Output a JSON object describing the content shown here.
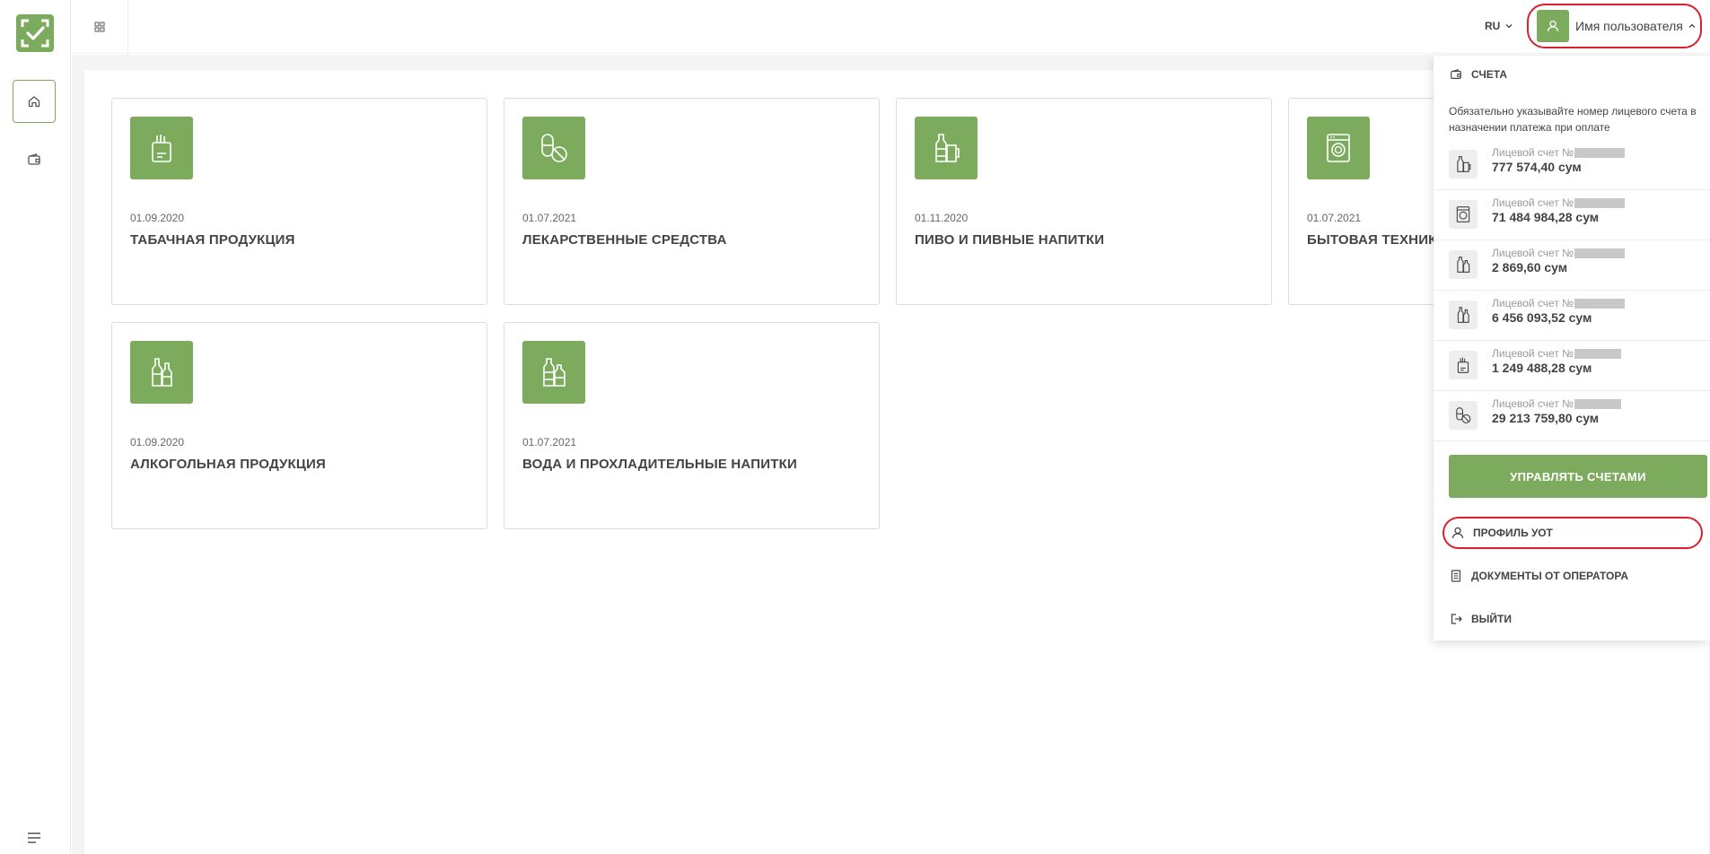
{
  "topbar": {
    "language": "RU",
    "user_name": "Имя пользователя"
  },
  "cards": [
    {
      "date": "01.09.2020",
      "title": "ТАБАЧНАЯ ПРОДУКЦИЯ",
      "icon": "tobacco-icon"
    },
    {
      "date": "01.07.2021",
      "title": "ЛЕКАРСТВЕННЫЕ СРЕДСТВА",
      "icon": "pills-icon"
    },
    {
      "date": "01.11.2020",
      "title": "ПИВО И ПИВНЫЕ НАПИТКИ",
      "icon": "beer-icon"
    },
    {
      "date": "01.07.2021",
      "title": "БЫТОВАЯ ТЕХНИКА",
      "icon": "washing-machine-icon"
    },
    {
      "date": "01.09.2020",
      "title": "АЛКОГОЛЬНАЯ ПРОДУКЦИЯ",
      "icon": "alcohol-icon"
    },
    {
      "date": "01.07.2021",
      "title": "ВОДА И ПРОХЛАДИТЕЛЬНЫЕ НАПИТКИ",
      "icon": "water-icon"
    }
  ],
  "dropdown": {
    "header": "СЧЕТА",
    "note": "Обязательно указывайте номер лицевого счета в назначении платежа при оплате",
    "accounts": [
      {
        "label": "Лицевой счет №",
        "value": "777 574,40 сум",
        "icon": "beer-icon"
      },
      {
        "label": "Лицевой счет №",
        "value": "71 484 984,28 сум",
        "icon": "washing-machine-icon"
      },
      {
        "label": "Лицевой счет №",
        "value": "2 869,60 сум",
        "icon": "water-icon"
      },
      {
        "label": "Лицевой счет №",
        "value": "6 456 093,52 сум",
        "icon": "alcohol-icon"
      },
      {
        "label": "Лицевой счет №",
        "value": "1 249 488,28 сум",
        "icon": "tobacco-icon"
      },
      {
        "label": "Лицевой счет №",
        "value": "29 213 759,80 сум",
        "icon": "pills-icon"
      }
    ],
    "manage_button": "УПРАВЛЯТЬ СЧЕТАМИ",
    "menu": [
      {
        "label": "ПРОФИЛЬ УОТ",
        "icon": "user-icon"
      },
      {
        "label": "ДОКУМЕНТЫ ОТ ОПЕРАТОРА",
        "icon": "document-icon"
      },
      {
        "label": "ВЫЙТИ",
        "icon": "logout-icon"
      }
    ]
  },
  "colors": {
    "accent": "#7cab5e",
    "highlight": "#d8202f"
  }
}
